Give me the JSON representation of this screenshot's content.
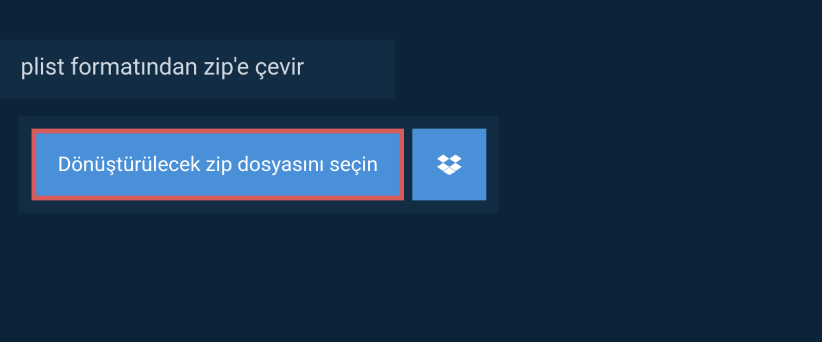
{
  "header": {
    "title": "plist formatından zip'e çevir"
  },
  "actions": {
    "select_file_label": "Dönüştürülecek zip dosyasını seçin",
    "dropbox_label": "dropbox"
  },
  "colors": {
    "page_bg": "#0d2438",
    "panel_bg": "#122c44",
    "button_bg": "#4a90d9",
    "button_border": "#d85a5a",
    "text_light": "#d0d8e0",
    "text_white": "#ffffff"
  }
}
